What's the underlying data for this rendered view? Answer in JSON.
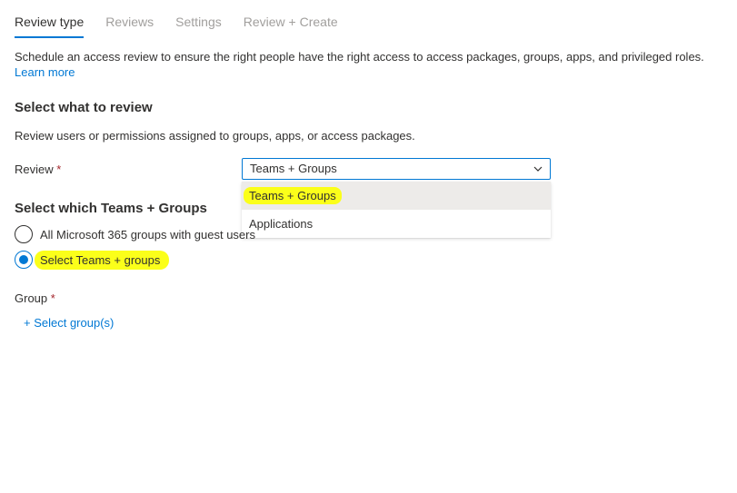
{
  "tabs": [
    {
      "label": "Review type",
      "active": true
    },
    {
      "label": "Reviews",
      "active": false
    },
    {
      "label": "Settings",
      "active": false
    },
    {
      "label": "Review + Create",
      "active": false
    }
  ],
  "intro": {
    "text": "Schedule an access review to ensure the right people have the right access to access packages, groups, apps, and privileged roles.",
    "learn_more": "Learn more"
  },
  "section_review": {
    "title": "Select what to review",
    "description": "Review users or permissions assigned to groups, apps, or access packages."
  },
  "review_field": {
    "label": "Review",
    "required_mark": "*",
    "value": "Teams + Groups",
    "options": [
      "Teams + Groups",
      "Applications"
    ]
  },
  "section_scope": {
    "title": "Select which Teams + Groups",
    "options": [
      {
        "label": "All Microsoft 365 groups with guest users",
        "selected": false
      },
      {
        "label": "Select Teams + groups",
        "selected": true
      }
    ]
  },
  "group_field": {
    "label": "Group",
    "required_mark": "*",
    "add_link": "+ Select group(s)"
  },
  "colors": {
    "accent": "#0078d4",
    "required": "#a4262c",
    "highlight": "#fbff1a"
  }
}
